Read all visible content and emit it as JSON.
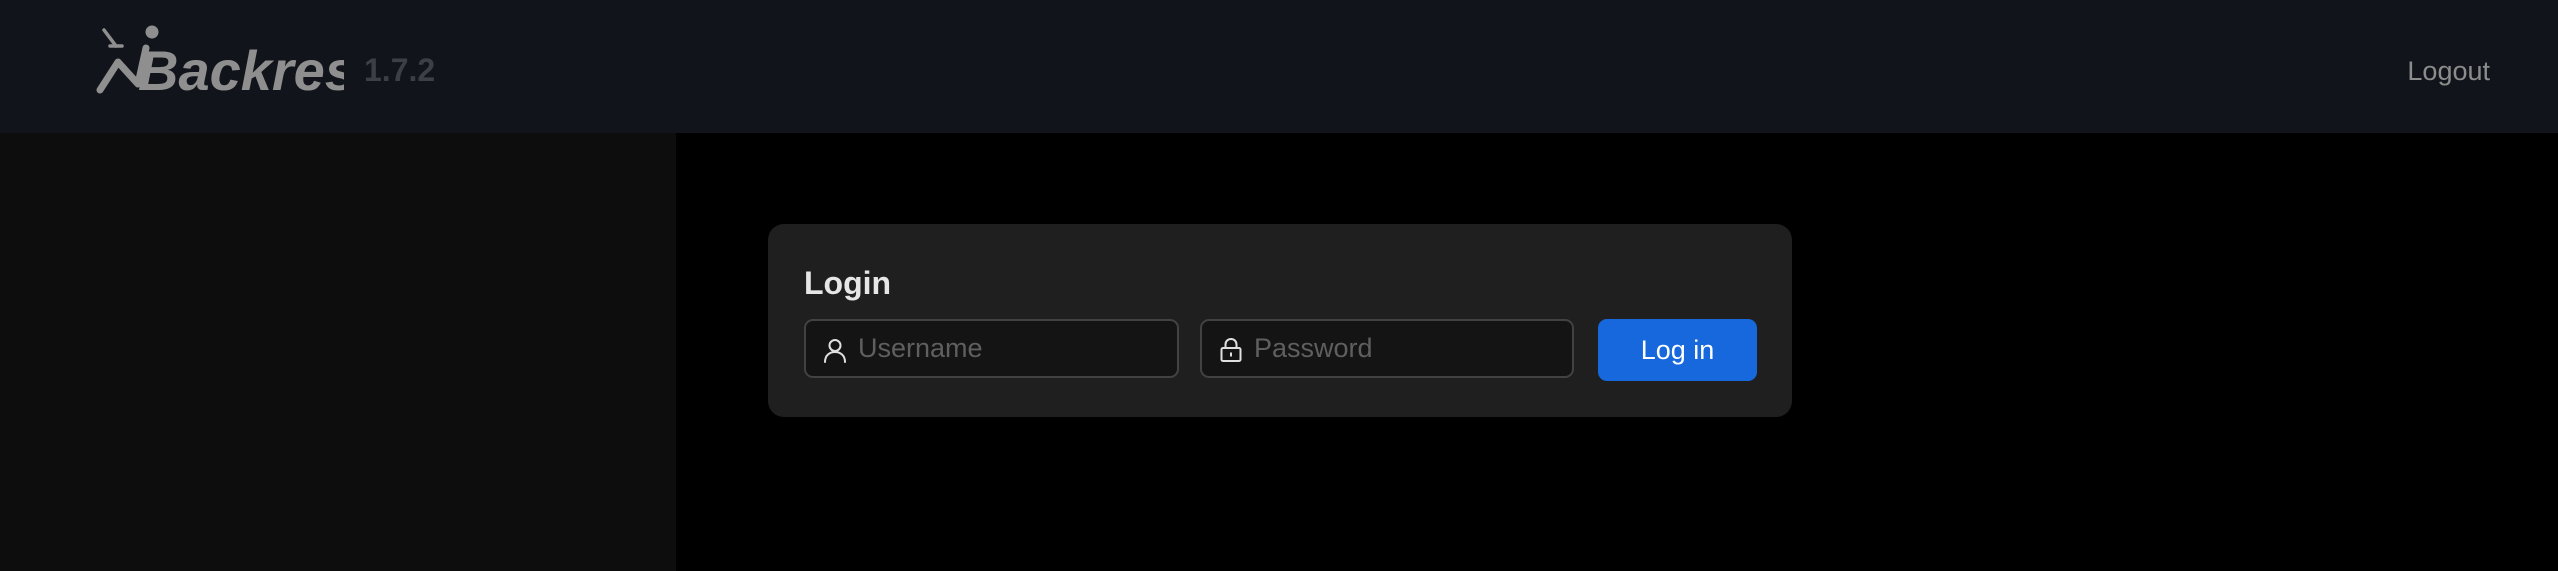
{
  "header": {
    "logo_text": "Backrest",
    "version": "1.7.2",
    "logout_label": "Logout"
  },
  "login": {
    "title": "Login",
    "username_placeholder": "Username",
    "username_value": "",
    "password_placeholder": "Password",
    "password_value": "",
    "submit_label": "Log in"
  },
  "icons": {
    "logo": "backrest-logo",
    "username": "user-icon",
    "password": "lock-icon"
  },
  "colors": {
    "header_bg": "#11141a",
    "sidebar_bg": "#0d0d0d",
    "main_bg": "#000000",
    "card_bg": "#1f1f1f",
    "primary": "#1668dc"
  }
}
